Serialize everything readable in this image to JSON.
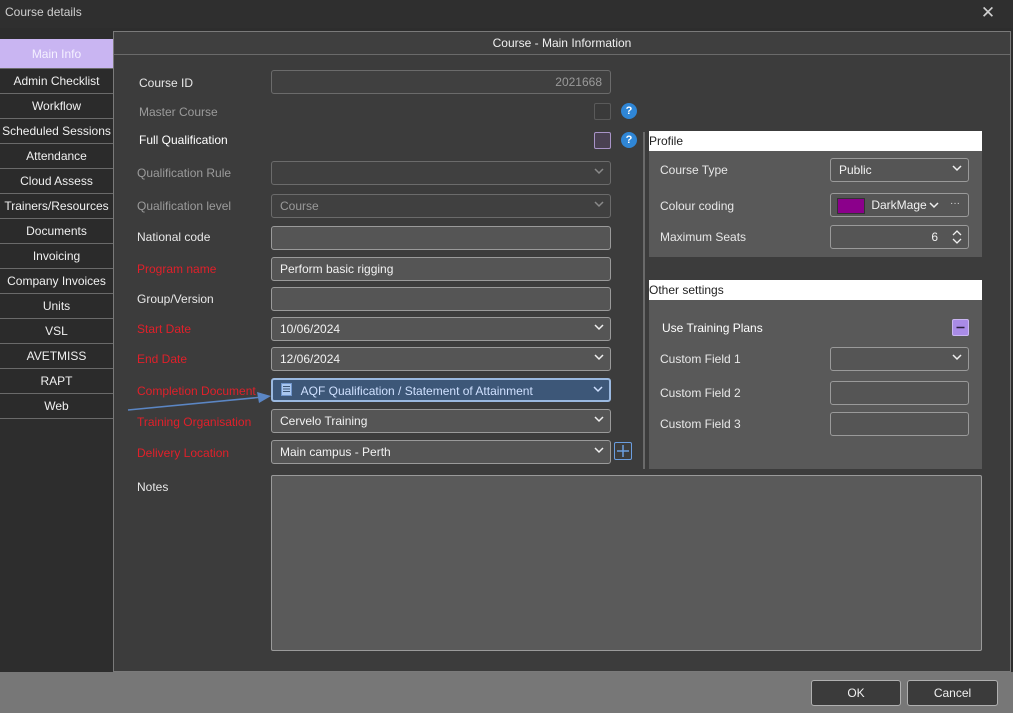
{
  "window": {
    "title": "Course details"
  },
  "sidebar": {
    "items": [
      {
        "label": "Main Info"
      },
      {
        "label": "Admin Checklist"
      },
      {
        "label": "Workflow"
      },
      {
        "label": "Scheduled Sessions"
      },
      {
        "label": "Attendance"
      },
      {
        "label": "Cloud Assess"
      },
      {
        "label": "Trainers/Resources"
      },
      {
        "label": "Documents"
      },
      {
        "label": "Invoicing"
      },
      {
        "label": "Company Invoices"
      },
      {
        "label": "Units"
      },
      {
        "label": "VSL"
      },
      {
        "label": "AVETMISS"
      },
      {
        "label": "RAPT"
      },
      {
        "label": "Web"
      }
    ]
  },
  "main": {
    "header": "Course - Main Information",
    "labels": {
      "course_id": "Course ID",
      "master_course": "Master Course",
      "full_qualification": "Full Qualification",
      "qualification_rule": "Qualification Rule",
      "qualification_level": "Qualification level",
      "national_code": "National code",
      "program_name": "Program name",
      "group_version": "Group/Version",
      "start_date": "Start Date",
      "end_date": "End Date",
      "completion_document": "Completion Document",
      "training_organisation": "Training Organisation",
      "delivery_location": "Delivery Location",
      "notes": "Notes"
    },
    "values": {
      "course_id": "2021668",
      "qualification_rule": "",
      "qualification_level": "Course",
      "national_code": "",
      "program_name": "Perform basic rigging",
      "group_version": "",
      "start_date": "10/06/2024",
      "end_date": "12/06/2024",
      "completion_document": "AQF Qualification / Statement of Attainment",
      "training_organisation": "Cervelo Training",
      "delivery_location": "Main campus - Perth",
      "notes": ""
    },
    "help_glyph": "?"
  },
  "profile": {
    "header": "Profile",
    "labels": {
      "course_type": "Course Type",
      "colour_coding": "Colour coding",
      "maximum_seats": "Maximum Seats"
    },
    "values": {
      "course_type": "Public",
      "colour_coding": "DarkMage",
      "colour_swatch": "#8b008b",
      "maximum_seats": "6",
      "ellipsis": "···"
    }
  },
  "other_settings": {
    "header": "Other settings",
    "labels": {
      "use_training_plans": "Use Training Plans",
      "custom_field_1": "Custom Field 1",
      "custom_field_2": "Custom Field 2",
      "custom_field_3": "Custom Field 3"
    },
    "values": {
      "custom_field_1": "",
      "custom_field_2": "",
      "custom_field_3": ""
    }
  },
  "footer": {
    "ok_label": "OK",
    "cancel_label": "Cancel"
  },
  "colors": {
    "accent": "#c9b5f2",
    "required": "#e0202a",
    "help": "#2f86d6",
    "selection": "#3d5778",
    "annotation_arrow": "#5b86c4"
  }
}
